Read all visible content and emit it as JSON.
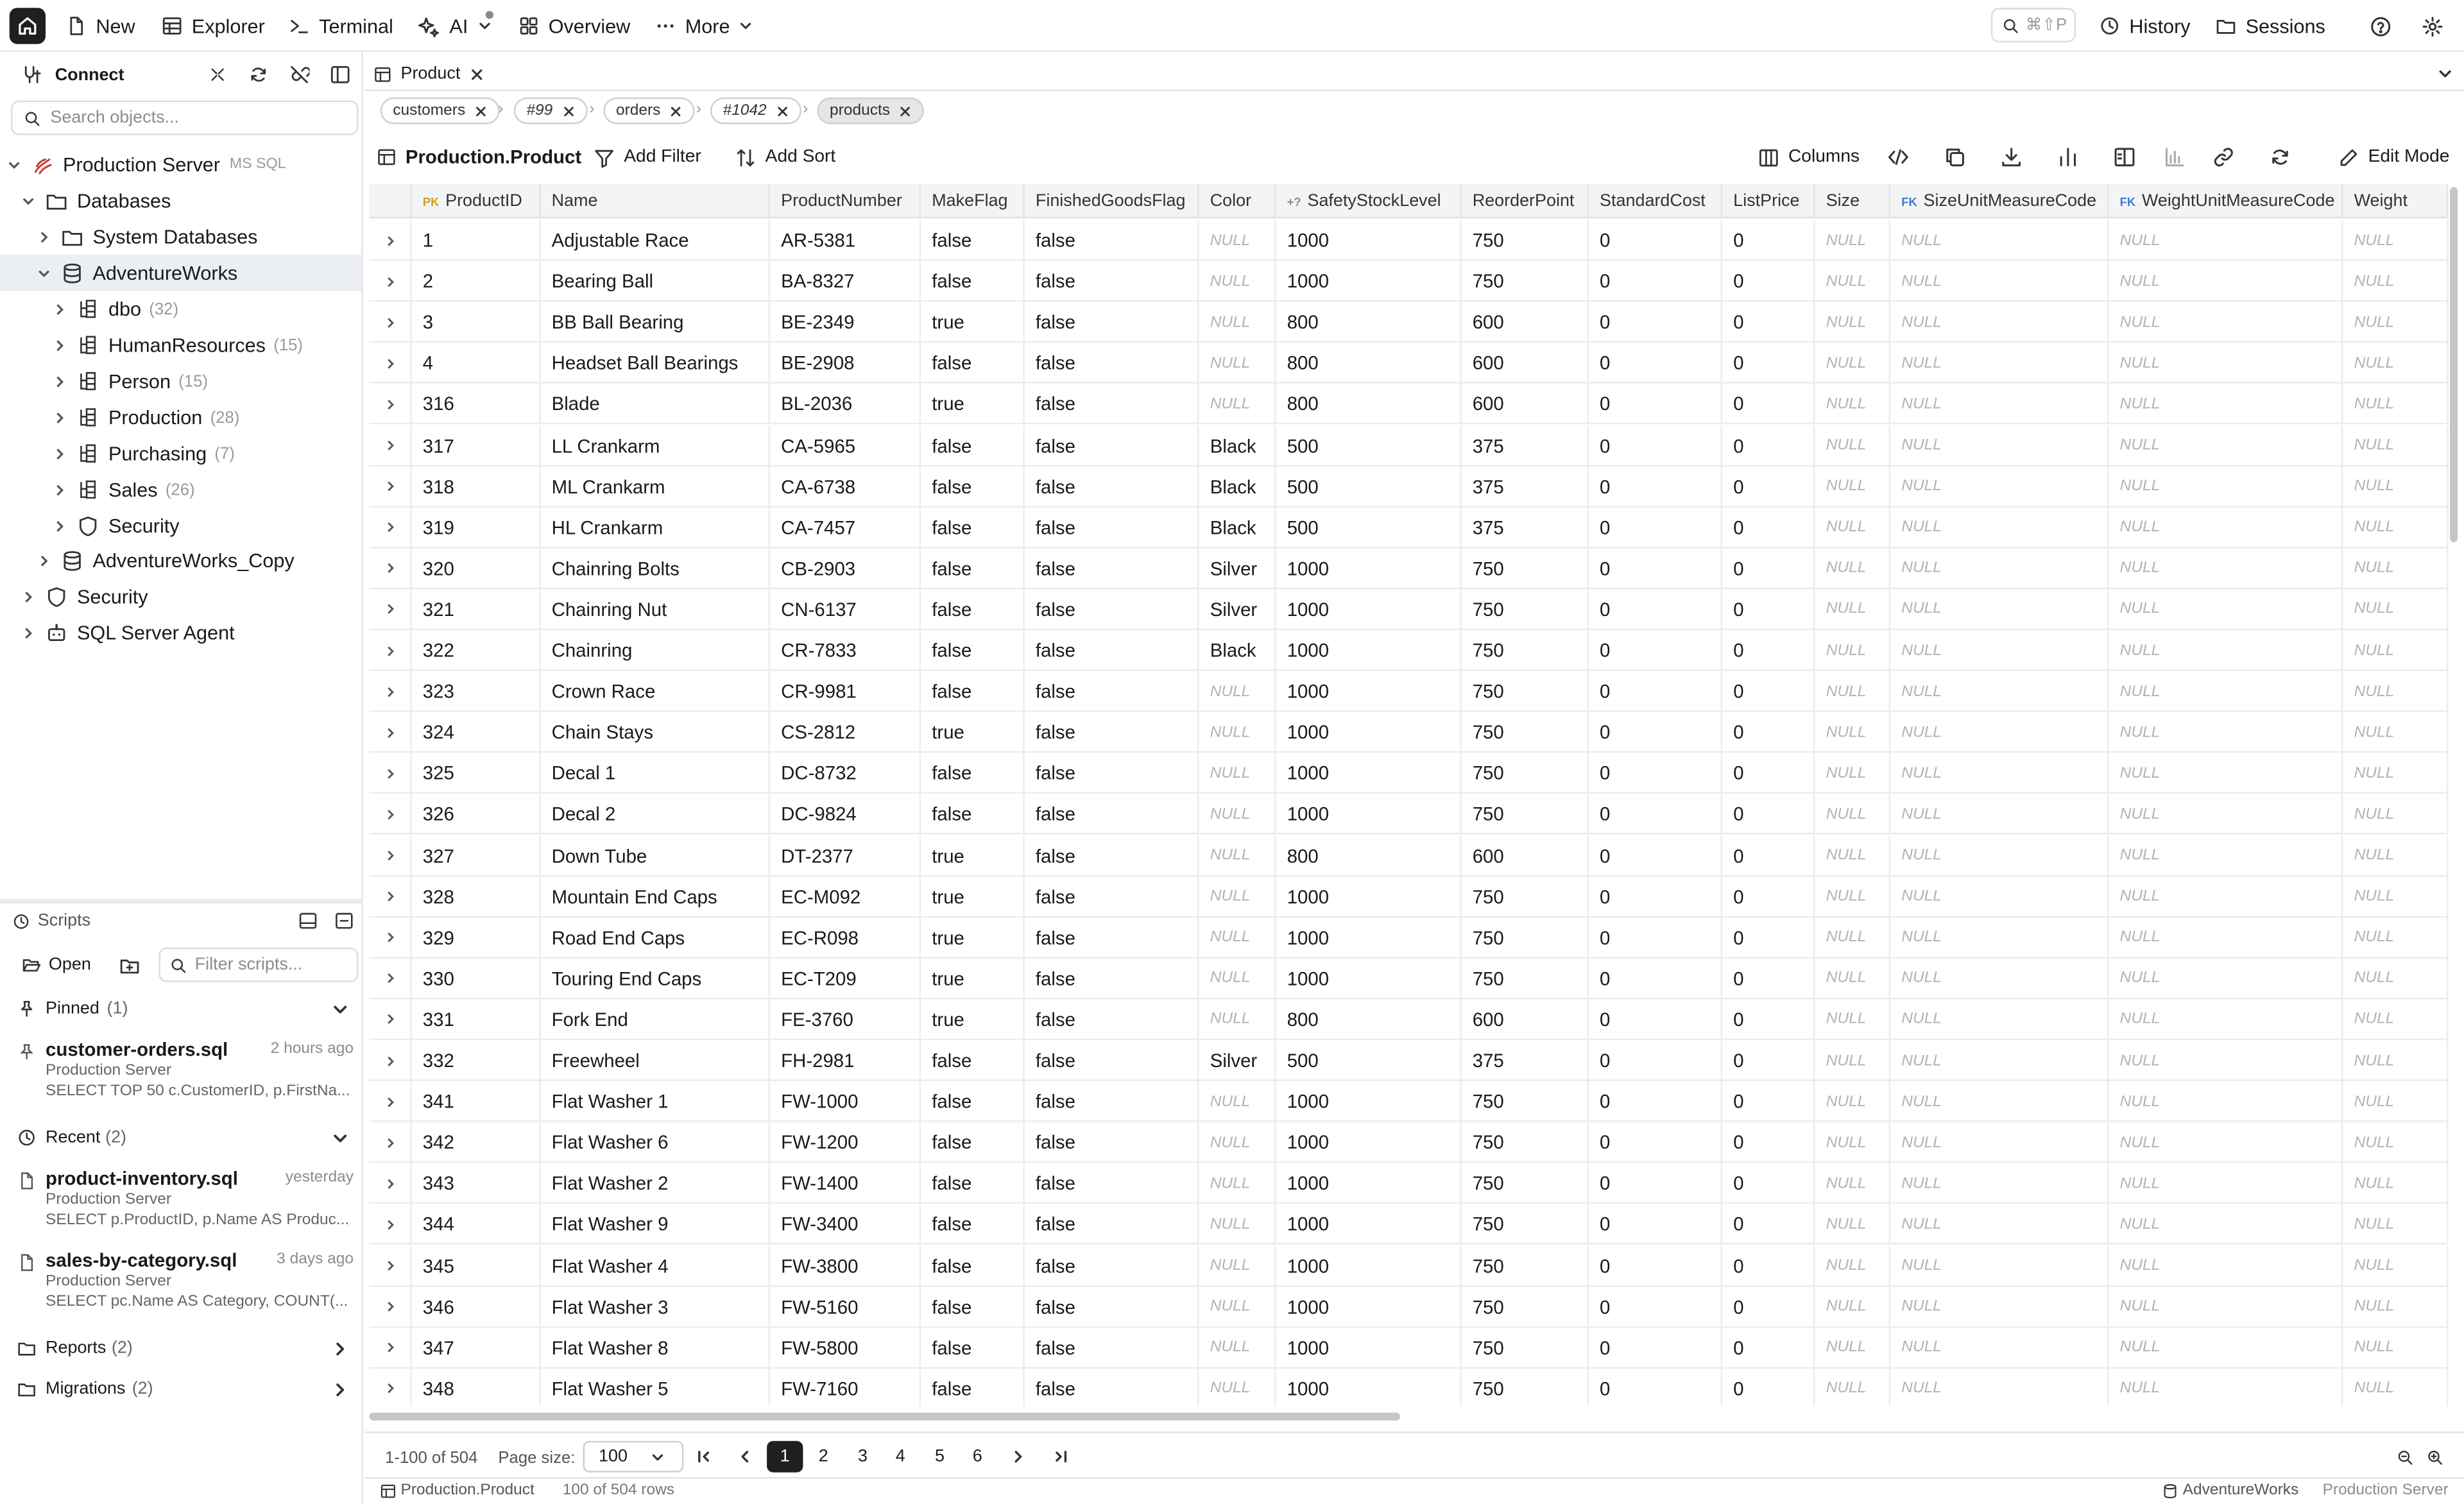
{
  "topbar": {
    "new": "New",
    "explorer": "Explorer",
    "terminal": "Terminal",
    "ai": "AI",
    "overview": "Overview",
    "more": "More",
    "shortcut": "⌘⇧P",
    "history": "History",
    "sessions": "Sessions"
  },
  "sidebar": {
    "title": "Connect",
    "search_placeholder": "Search objects...",
    "server": {
      "label": "Production Server",
      "tag": "MS SQL"
    },
    "tree": [
      {
        "label": "Databases"
      },
      {
        "label": "System Databases"
      },
      {
        "label": "AdventureWorks"
      },
      {
        "label": "dbo",
        "count": "(32)"
      },
      {
        "label": "HumanResources",
        "count": "(15)"
      },
      {
        "label": "Person",
        "count": "(15)"
      },
      {
        "label": "Production",
        "count": "(28)"
      },
      {
        "label": "Purchasing",
        "count": "(7)"
      },
      {
        "label": "Sales",
        "count": "(26)"
      },
      {
        "label": "Security"
      },
      {
        "label": "AdventureWorks_Copy"
      },
      {
        "label": "Security"
      },
      {
        "label": "SQL Server Agent"
      }
    ],
    "scripts": {
      "title": "Scripts",
      "open": "Open",
      "filter_placeholder": "Filter scripts...",
      "pinned_label": "Pinned",
      "pinned_count": "(1)",
      "pinned": [
        {
          "name": "customer-orders.sql",
          "time": "2 hours ago",
          "server": "Production Server",
          "query": "SELECT TOP 50 c.CustomerID, p.FirstNa..."
        }
      ],
      "recent_label": "Recent",
      "recent_count": "(2)",
      "recent": [
        {
          "name": "product-inventory.sql",
          "time": "yesterday",
          "server": "Production Server",
          "query": "SELECT p.ProductID, p.Name AS Produc..."
        },
        {
          "name": "sales-by-category.sql",
          "time": "3 days ago",
          "server": "Production Server",
          "query": "SELECT pc.Name AS Category, COUNT(..."
        }
      ],
      "reports_label": "Reports",
      "reports_count": "(2)",
      "migrations_label": "Migrations",
      "migrations_count": "(2)"
    }
  },
  "main": {
    "tab": "Product",
    "breadcrumbs": [
      "customers",
      "#99",
      "orders",
      "#1042",
      "products"
    ],
    "table_name": "Production.Product",
    "add_filter": "Add Filter",
    "add_sort": "Add Sort",
    "columns_btn": "Columns",
    "edit_mode": "Edit Mode",
    "columns": [
      "ProductID",
      "Name",
      "ProductNumber",
      "MakeFlag",
      "FinishedGoodsFlag",
      "Color",
      "SafetyStockLevel",
      "ReorderPoint",
      "StandardCost",
      "ListPrice",
      "Size",
      "SizeUnitMeasureCode",
      "WeightUnitMeasureCode",
      "Weight"
    ],
    "column_badges": [
      "PK",
      "",
      "",
      "",
      "",
      "",
      "+?",
      "",
      "",
      "",
      "",
      "FK",
      "FK",
      ""
    ],
    "null_text": "NULL",
    "rows": [
      [
        "1",
        "Adjustable Race",
        "AR-5381",
        "false",
        "false",
        null,
        "1000",
        "750",
        "0",
        "0"
      ],
      [
        "2",
        "Bearing Ball",
        "BA-8327",
        "false",
        "false",
        null,
        "1000",
        "750",
        "0",
        "0"
      ],
      [
        "3",
        "BB Ball Bearing",
        "BE-2349",
        "true",
        "false",
        null,
        "800",
        "600",
        "0",
        "0"
      ],
      [
        "4",
        "Headset Ball Bearings",
        "BE-2908",
        "false",
        "false",
        null,
        "800",
        "600",
        "0",
        "0"
      ],
      [
        "316",
        "Blade",
        "BL-2036",
        "true",
        "false",
        null,
        "800",
        "600",
        "0",
        "0"
      ],
      [
        "317",
        "LL Crankarm",
        "CA-5965",
        "false",
        "false",
        "Black",
        "500",
        "375",
        "0",
        "0"
      ],
      [
        "318",
        "ML Crankarm",
        "CA-6738",
        "false",
        "false",
        "Black",
        "500",
        "375",
        "0",
        "0"
      ],
      [
        "319",
        "HL Crankarm",
        "CA-7457",
        "false",
        "false",
        "Black",
        "500",
        "375",
        "0",
        "0"
      ],
      [
        "320",
        "Chainring Bolts",
        "CB-2903",
        "false",
        "false",
        "Silver",
        "1000",
        "750",
        "0",
        "0"
      ],
      [
        "321",
        "Chainring Nut",
        "CN-6137",
        "false",
        "false",
        "Silver",
        "1000",
        "750",
        "0",
        "0"
      ],
      [
        "322",
        "Chainring",
        "CR-7833",
        "false",
        "false",
        "Black",
        "1000",
        "750",
        "0",
        "0"
      ],
      [
        "323",
        "Crown Race",
        "CR-9981",
        "false",
        "false",
        null,
        "1000",
        "750",
        "0",
        "0"
      ],
      [
        "324",
        "Chain Stays",
        "CS-2812",
        "true",
        "false",
        null,
        "1000",
        "750",
        "0",
        "0"
      ],
      [
        "325",
        "Decal 1",
        "DC-8732",
        "false",
        "false",
        null,
        "1000",
        "750",
        "0",
        "0"
      ],
      [
        "326",
        "Decal 2",
        "DC-9824",
        "false",
        "false",
        null,
        "1000",
        "750",
        "0",
        "0"
      ],
      [
        "327",
        "Down Tube",
        "DT-2377",
        "true",
        "false",
        null,
        "800",
        "600",
        "0",
        "0"
      ],
      [
        "328",
        "Mountain End Caps",
        "EC-M092",
        "true",
        "false",
        null,
        "1000",
        "750",
        "0",
        "0"
      ],
      [
        "329",
        "Road End Caps",
        "EC-R098",
        "true",
        "false",
        null,
        "1000",
        "750",
        "0",
        "0"
      ],
      [
        "330",
        "Touring End Caps",
        "EC-T209",
        "true",
        "false",
        null,
        "1000",
        "750",
        "0",
        "0"
      ],
      [
        "331",
        "Fork End",
        "FE-3760",
        "true",
        "false",
        null,
        "800",
        "600",
        "0",
        "0"
      ],
      [
        "332",
        "Freewheel",
        "FH-2981",
        "false",
        "false",
        "Silver",
        "500",
        "375",
        "0",
        "0"
      ],
      [
        "341",
        "Flat Washer 1",
        "FW-1000",
        "false",
        "false",
        null,
        "1000",
        "750",
        "0",
        "0"
      ],
      [
        "342",
        "Flat Washer 6",
        "FW-1200",
        "false",
        "false",
        null,
        "1000",
        "750",
        "0",
        "0"
      ],
      [
        "343",
        "Flat Washer 2",
        "FW-1400",
        "false",
        "false",
        null,
        "1000",
        "750",
        "0",
        "0"
      ],
      [
        "344",
        "Flat Washer 9",
        "FW-3400",
        "false",
        "false",
        null,
        "1000",
        "750",
        "0",
        "0"
      ],
      [
        "345",
        "Flat Washer 4",
        "FW-3800",
        "false",
        "false",
        null,
        "1000",
        "750",
        "0",
        "0"
      ],
      [
        "346",
        "Flat Washer 3",
        "FW-5160",
        "false",
        "false",
        null,
        "1000",
        "750",
        "0",
        "0"
      ],
      [
        "347",
        "Flat Washer 8",
        "FW-5800",
        "false",
        "false",
        null,
        "1000",
        "750",
        "0",
        "0"
      ],
      [
        "348",
        "Flat Washer 5",
        "FW-7160",
        "false",
        "false",
        null,
        "1000",
        "750",
        "0",
        "0"
      ]
    ],
    "pager": {
      "range": "1-100 of 504",
      "page_size_label": "Page size:",
      "page_size": "100",
      "pages": [
        "1",
        "2",
        "3",
        "4",
        "5",
        "6"
      ],
      "current": "1"
    },
    "status": {
      "table": "Production.Product",
      "rows": "100 of 504 rows",
      "database": "AdventureWorks",
      "server": "Production Server"
    }
  }
}
